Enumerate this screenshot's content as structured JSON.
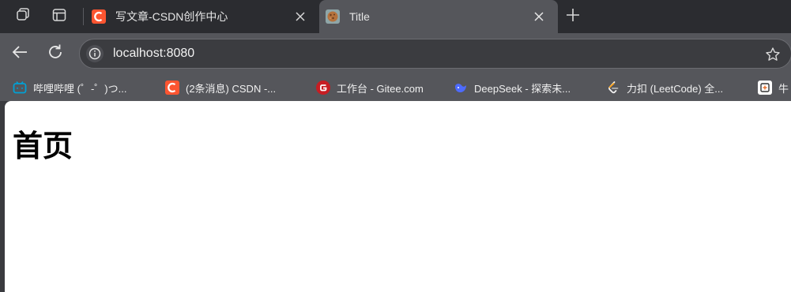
{
  "tabs": [
    {
      "title": "写文章-CSDN创作中心",
      "favicon": "csdn-icon",
      "active": false
    },
    {
      "title": "Title",
      "favicon": "cookie-icon",
      "active": true
    }
  ],
  "toolbar": {
    "url": "localhost:8080",
    "icons": [
      "back-icon",
      "reload-icon",
      "info-icon",
      "star-icon"
    ]
  },
  "bookmarks": [
    {
      "label": "哔哩哔哩 (゜-゜)つ...",
      "icon": "bilibili-icon"
    },
    {
      "label": "(2条消息) CSDN -...",
      "icon": "csdn-icon"
    },
    {
      "label": "工作台 - Gitee.com",
      "icon": "gitee-icon"
    },
    {
      "label": "DeepSeek - 探索未...",
      "icon": "deepseek-icon"
    },
    {
      "label": "力扣 (LeetCode) 全...",
      "icon": "leetcode-icon"
    },
    {
      "label": "牛",
      "icon": "nowcoder-icon"
    }
  ],
  "page": {
    "heading": "首页"
  },
  "colors": {
    "tabstrip": "#2b2c30",
    "toolbar": "#55565b",
    "csdn": "#fc5531",
    "gitee": "#c71d23",
    "bilibili": "#00a1d6",
    "deepseek": "#4d6bfe"
  }
}
